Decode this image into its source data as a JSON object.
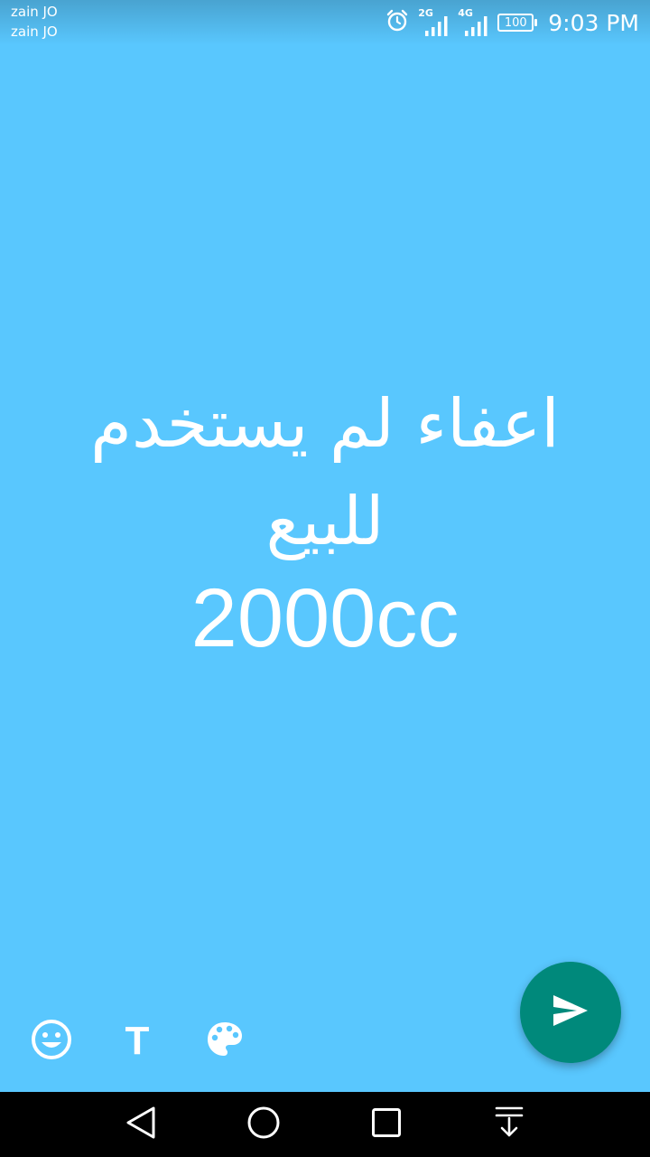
{
  "status_bar": {
    "carrier_1": "zain JO",
    "carrier_2": "zain JO",
    "network_1": "2G",
    "network_2": "4G",
    "battery": "100",
    "time": "9:03 PM",
    "icons": [
      "alarm-icon",
      "signal-icon",
      "signal-icon",
      "battery-icon"
    ]
  },
  "status_text": {
    "line_1": "اعفاء لم يستخدم",
    "line_2": "للبيع",
    "line_3": "2000cc"
  },
  "toolbar": {
    "icons": [
      "emoji-icon",
      "text-icon",
      "palette-icon"
    ],
    "text_glyph": "T",
    "send_icon": "send-icon"
  },
  "nav_bar": {
    "icons": [
      "back-icon",
      "home-icon",
      "recents-icon",
      "notification-pull-icon"
    ]
  },
  "colors": {
    "background": "#59c7fe",
    "fab": "#00897b",
    "text": "#ffffff",
    "nav": "#000000"
  }
}
